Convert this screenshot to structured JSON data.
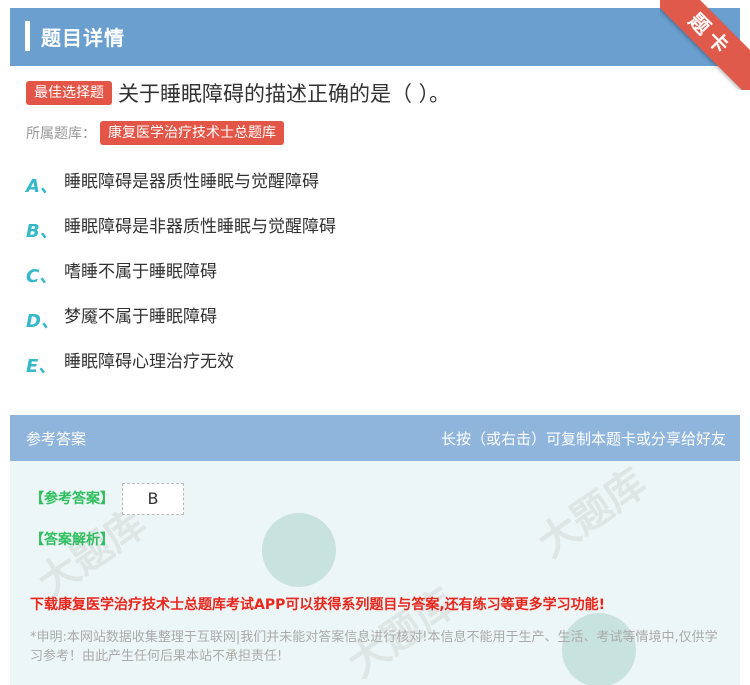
{
  "header": {
    "title": "题目详情",
    "corner_label": "题卡"
  },
  "question": {
    "type_tag": "最佳选择题",
    "text": "关于睡眠障碍的描述正确的是（ ）。"
  },
  "bank": {
    "label": "所属题库：",
    "name": "康复医学治疗技术士总题库"
  },
  "options": [
    {
      "letter": "A、",
      "text": "睡眠障碍是器质性睡眠与觉醒障碍"
    },
    {
      "letter": "B、",
      "text": "睡眠障碍是非器质性睡眠与觉醒障碍"
    },
    {
      "letter": "C、",
      "text": "嗜睡不属于睡眠障碍"
    },
    {
      "letter": "D、",
      "text": "梦魇不属于睡眠障碍"
    },
    {
      "letter": "E、",
      "text": "睡眠障碍心理治疗无效"
    }
  ],
  "answer_section": {
    "title": "参考答案",
    "hint": "长按（或右击）可复制本题卡或分享给好友",
    "answer_label": "【参考答案】",
    "answer_value": "B",
    "analysis_label": "【答案解析】",
    "promo": "下载康复医学治疗技术士总题库考试APP可以获得系列题目与答案,还有练习等更多学习功能!",
    "notice": "*申明:本网站数据收集整理于互联网|我们并未能对答案信息进行核对!本信息不能用于生产、生活、考试等情境中,仅供学习参考！由此产生任何后果本站不承担责任!"
  },
  "colors": {
    "header_bg": "#6a9fd0",
    "tag_red": "#e25547",
    "option_letter": "#35b8c8",
    "answer_green": "#2fbf5e",
    "promo_red": "#e8261c"
  }
}
